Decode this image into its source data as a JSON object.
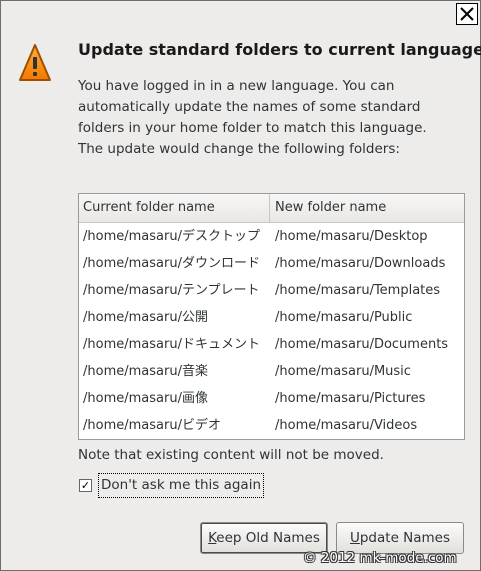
{
  "dialog": {
    "title": "Update standard folders to current language?",
    "description": "You have logged in in a new language. You can automatically update the names of some standard folders in your home folder to match this language. The update would change the following folders:",
    "table": {
      "headers": [
        "Current folder name",
        "New folder name"
      ],
      "rows": [
        [
          "/home/masaru/デスクトップ",
          "/home/masaru/Desktop"
        ],
        [
          "/home/masaru/ダウンロード",
          "/home/masaru/Downloads"
        ],
        [
          "/home/masaru/テンプレート",
          "/home/masaru/Templates"
        ],
        [
          "/home/masaru/公開",
          "/home/masaru/Public"
        ],
        [
          "/home/masaru/ドキュメント",
          "/home/masaru/Documents"
        ],
        [
          "/home/masaru/音楽",
          "/home/masaru/Music"
        ],
        [
          "/home/masaru/画像",
          "/home/masaru/Pictures"
        ],
        [
          "/home/masaru/ビデオ",
          "/home/masaru/Videos"
        ]
      ]
    },
    "note": "Note that existing content will not be moved.",
    "checkbox": {
      "label": "Don't ask me this again",
      "checked": true,
      "mark": "✓"
    },
    "buttons": {
      "keep": {
        "mnemonic": "K",
        "rest": "eep Old Names"
      },
      "update": {
        "mnemonic": "U",
        "rest": "pdate Names"
      }
    }
  },
  "icons": {
    "warning": "warning-icon",
    "close": "close-icon"
  },
  "colors": {
    "warning_fill": "#f57900",
    "warning_stroke": "#a14d00",
    "dialog_bg": "#edeceb"
  },
  "watermark": "© 2012 mk-mode.com"
}
